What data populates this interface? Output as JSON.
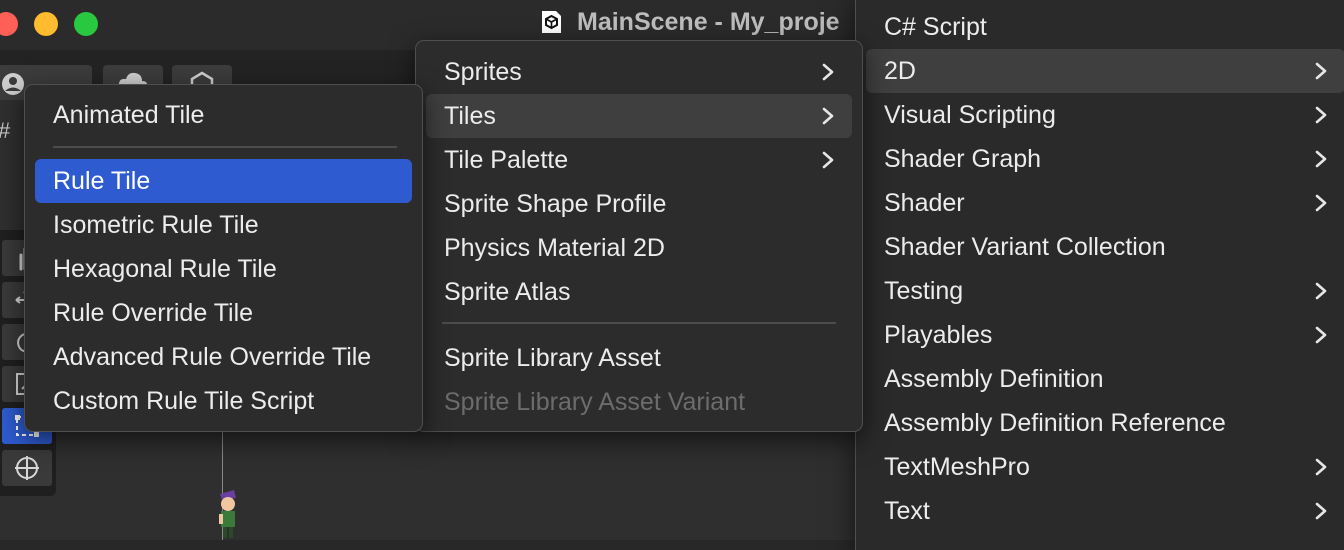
{
  "window": {
    "title": "MainScene - My_proje"
  },
  "menu_create": {
    "items": [
      {
        "label": "C# Script",
        "submenu": false
      },
      {
        "label": "2D",
        "submenu": true,
        "state": "hover"
      },
      {
        "label": "Visual Scripting",
        "submenu": true
      },
      {
        "label": "Shader Graph",
        "submenu": true
      },
      {
        "label": "Shader",
        "submenu": true
      },
      {
        "label": "Shader Variant Collection",
        "submenu": false
      },
      {
        "label": "Testing",
        "submenu": true
      },
      {
        "label": "Playables",
        "submenu": true
      },
      {
        "label": "Assembly Definition",
        "submenu": false
      },
      {
        "label": "Assembly Definition Reference",
        "submenu": false
      },
      {
        "label": "TextMeshPro",
        "submenu": true
      },
      {
        "label": "Text",
        "submenu": true
      }
    ]
  },
  "menu_2d": {
    "items": [
      {
        "label": "Sprites",
        "submenu": true
      },
      {
        "label": "Tiles",
        "submenu": true,
        "state": "hover"
      },
      {
        "label": "Tile Palette",
        "submenu": true
      },
      {
        "label": "Sprite Shape Profile",
        "submenu": false
      },
      {
        "label": "Physics Material 2D",
        "submenu": false
      },
      {
        "label": "Sprite Atlas",
        "submenu": false
      },
      {
        "label": "Sprite Library Asset",
        "submenu": false
      },
      {
        "label": "Sprite Library Asset Variant",
        "submenu": false,
        "state": "disabled"
      }
    ]
  },
  "menu_tiles": {
    "items": [
      {
        "label": "Animated Tile"
      },
      {
        "label": "Rule Tile",
        "state": "selected"
      },
      {
        "label": "Isometric Rule Tile"
      },
      {
        "label": "Hexagonal Rule Tile"
      },
      {
        "label": "Rule Override Tile"
      },
      {
        "label": "Advanced Rule Override Tile"
      },
      {
        "label": "Custom Rule Tile Script"
      }
    ]
  },
  "icons": {
    "window": "unity-logo-icon",
    "submenu": "chevron-right-icon",
    "tools": [
      "hand-tool-icon",
      "move-tool-icon",
      "rotate-tool-icon",
      "scale-tool-icon",
      "rect-tool-icon",
      "transform-tool-icon"
    ]
  },
  "colors": {
    "selection": "#2e5bd0",
    "hover": "#3f3f3f",
    "menu_bg": "#2c2c2c",
    "traffic_close": "#fe5f57",
    "traffic_min": "#febc2e",
    "traffic_max": "#28c840"
  }
}
